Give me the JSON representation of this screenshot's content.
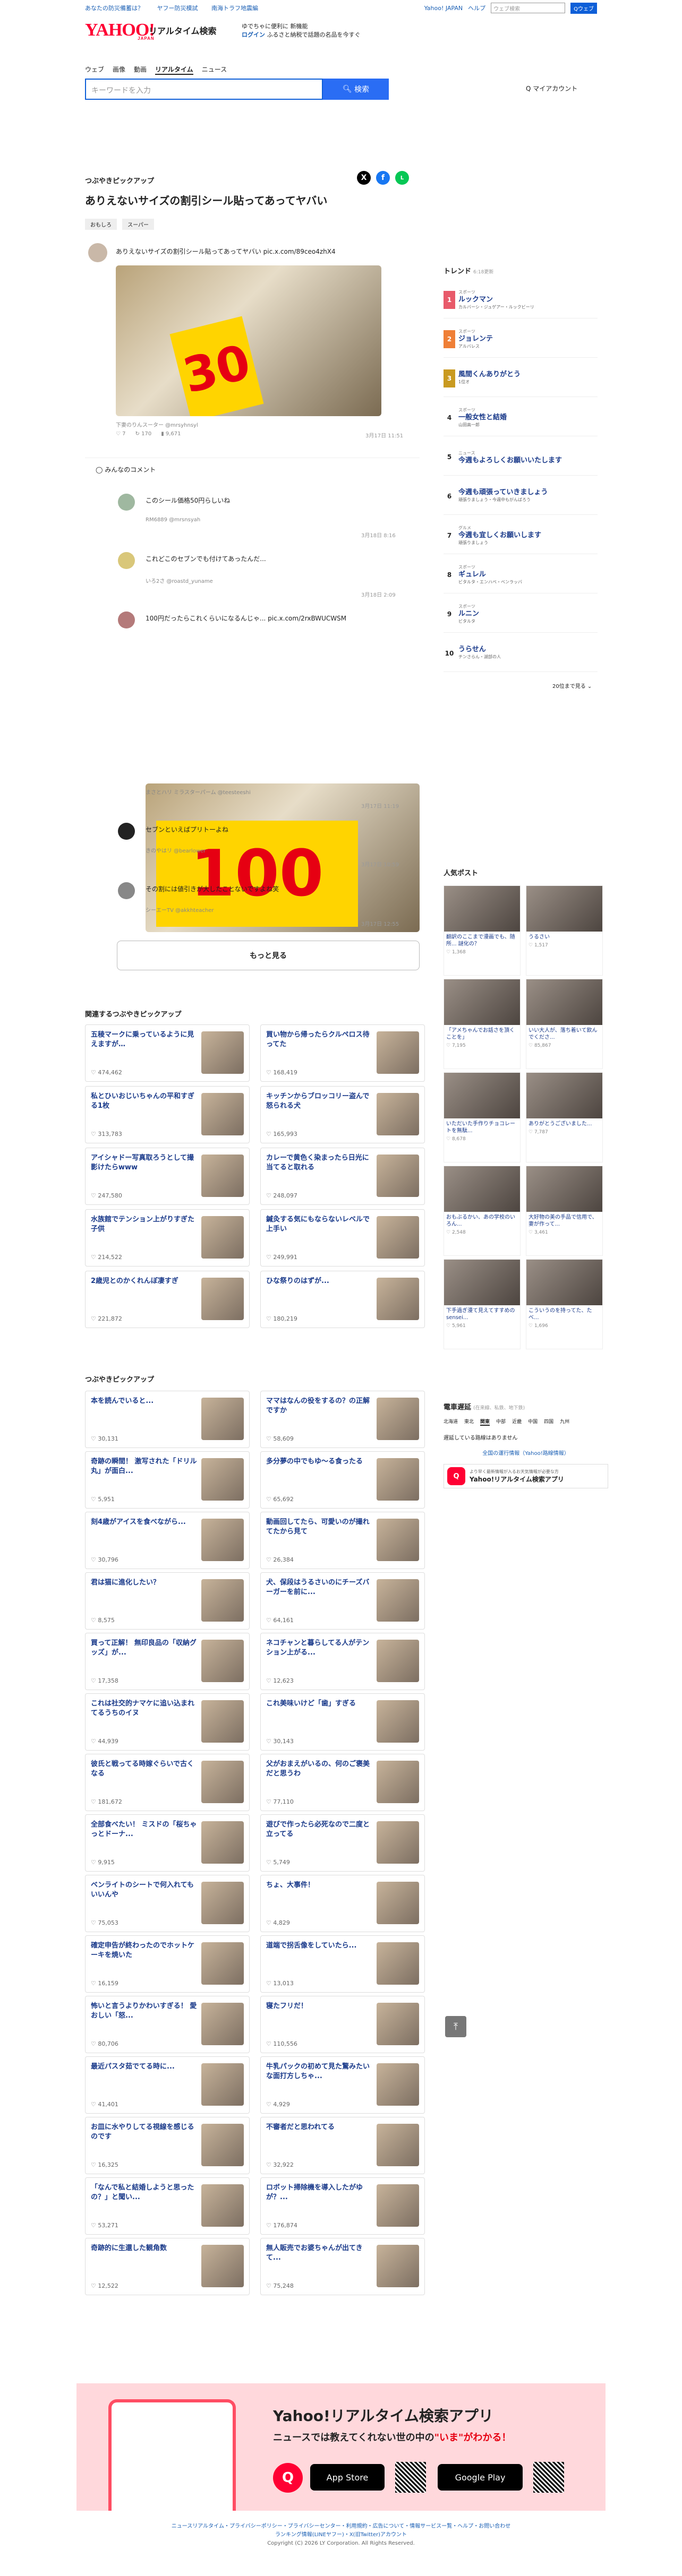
{
  "topbar": {
    "links": [
      "あなたの防災備蓄は？",
      "ヤフー防災模試",
      "南海トラフ地震編"
    ],
    "yahoo_japan": "Yahoo! JAPAN",
    "help": "ヘルプ",
    "search_placeholder": "ウェブ検索",
    "search_btn": "Qウェブ"
  },
  "header": {
    "logo": "YAHOO!",
    "logo_sub": "JAPAN",
    "title": "リアルタイム検索",
    "promo1": "ゆでちゃに便利に 新機能",
    "promo2": "ログイン",
    "promo3": "ふるさと納税で話題の名品を今すぐ"
  },
  "nav": {
    "items": [
      "ウェブ",
      "画像",
      "動画",
      "リアルタイム",
      "ニュース"
    ]
  },
  "search": {
    "placeholder": "キーワードを入力",
    "button": "検索",
    "mylink": "Q マイアカウント"
  },
  "main": {
    "pickup_label": "つぶやきピックアップ",
    "headline": "ありえないサイズの割引シール貼ってあってヤバい",
    "tags": [
      "おもしろ",
      "スーパー"
    ],
    "post1": {
      "text": "ありえないサイズの割引シール貼ってあってヤバい pic.x.com/89ceo4zhX4",
      "sticker": "30",
      "user": "下妻のりんスーター @mrsyhnsyl",
      "likes": "7",
      "rts": "170",
      "views": "9,671",
      "date": "3月17日 11:51"
    },
    "comments_label": "みんなのコメント",
    "c1": {
      "text": "このシール価格50円らしいね",
      "user": "RM6889 @mrsnsyah",
      "date": "3月18日 8:16"
    },
    "c2": {
      "text": "これどこのセブンでも付けてあったんだ...",
      "user": "いろ2さ @roastd_yuname",
      "date": "3月18日 2:09"
    },
    "c3": {
      "text": "100円だったらこれくらいになるんじゃ... pic.x.com/2rxBWUCWSM",
      "sticker": "100",
      "user": "まさとハリ ミラスターパーム @teesteeshi",
      "date": "3月17日 11:19"
    },
    "c4": {
      "text": "セブンといえばプリトーよね",
      "user": "きのやはリ @bearlower",
      "date": "3月17日 10:59"
    },
    "c5": {
      "text": "その割には値引きが大したことないですよね笑",
      "user": "シーエーTV @akkhteacher",
      "date": "3月17日 12:55"
    },
    "more": "もっと見る",
    "related_label": "関連するつぶやきピックアップ",
    "related": [
      {
        "t": "五稜マークに乗っているように見えますが…",
        "c": "474,462"
      },
      {
        "t": "買い物から帰ったらクルペロス待ってた",
        "c": "168,419"
      },
      {
        "t": "私とひいおじいちゃんの平和すぎる1枚",
        "c": "313,783"
      },
      {
        "t": "キッチンからブロッコリー盗んで怒られる犬",
        "c": "165,993"
      },
      {
        "t": "アイシャドー写真取ろうとして撮影けたらwww",
        "c": "247,580"
      },
      {
        "t": "カレーで黄色く染まったら日光に当てると取れる",
        "c": "248,097"
      },
      {
        "t": "水族館でテンション上がりすぎた子供",
        "c": "214,522"
      },
      {
        "t": "鍼灸する気にもならないレベルで上手い",
        "c": "249,991"
      },
      {
        "t": "2歳児とのかくれんぼ凄すぎ",
        "c": "221,872"
      },
      {
        "t": "ひな祭りのはずが...",
        "c": "180,219"
      }
    ],
    "pickup2_label": "つぶやきピックアップ",
    "pickups": [
      {
        "t": "本を読んでいると...",
        "c": "30,131"
      },
      {
        "t": "ママはなんの役をするの？の正解ですか",
        "c": "58,609"
      },
      {
        "t": "奇跡の瞬間！ 激写された「ドリル丸」が面白...",
        "c": "5,951"
      },
      {
        "t": "多分夢の中でもゆ〜る食ったる",
        "c": "65,692"
      },
      {
        "t": "刻4歳がアイスを食べながら...",
        "c": "30,796"
      },
      {
        "t": "動画回してたら、可愛いのが撮れてたから見て",
        "c": "26,384"
      },
      {
        "t": "君は猫に進化したい？",
        "c": "8,575"
      },
      {
        "t": "犬、保段はうるさいのにチーズバーガーを前に...",
        "c": "64,161"
      },
      {
        "t": "買って正解！ 無印良品の「収納グッズ」が...",
        "c": "17,358"
      },
      {
        "t": "ネコチャンと暮らしてる人がテンション上がる...",
        "c": "12,623"
      },
      {
        "t": "これは社交的ナマケに追い込まれてるうちのイヌ",
        "c": "44,939"
      },
      {
        "t": "これ美味いけど「歯」すぎる",
        "c": "30,143"
      },
      {
        "t": "彼氏と戦ってる時嫁ぐらいで古くなる",
        "c": "181,672"
      },
      {
        "t": "父がおまえがいるの、何のご褒美だと思うわ",
        "c": "77,110"
      },
      {
        "t": "全部食べたい！ ミスドの「桜ちゃっとドーナ...",
        "c": "9,915"
      },
      {
        "t": "遊びで作ったら必死なので二度と立ってる",
        "c": "5,749"
      },
      {
        "t": "ベンライトのシートで何入れてもいいんや",
        "c": "75,053"
      },
      {
        "t": "ちょ、大事件！",
        "c": "4,829"
      },
      {
        "t": "確定申告が終わったのでホットケーキを焼いた",
        "c": "16,159"
      },
      {
        "t": "道端で拐舌像をしていたら...",
        "c": "13,013"
      },
      {
        "t": "怖いと言うよりかわいすぎる！ 愛おしい「怒...",
        "c": "80,706"
      },
      {
        "t": "寝たフリだ！",
        "c": "110,556"
      },
      {
        "t": "最近パスタ茹でてる時に...",
        "c": "41,401"
      },
      {
        "t": "牛乳パックの初めて見た驚みたいな面打方しちゃ...",
        "c": "4,929"
      },
      {
        "t": "お皿に水やりしてる視線を感じるのです",
        "c": "16,325"
      },
      {
        "t": "不審者だと思われてる",
        "c": "32,922"
      },
      {
        "t": "「なんで私と結婚しようと思ったの？」と聞い...",
        "c": "53,271"
      },
      {
        "t": "ロボット掃除機を導入したがゆが？...",
        "c": "176,874"
      },
      {
        "t": "奇跡的に生還した観角数",
        "c": "12,522"
      },
      {
        "t": "無人販売でお婆ちゃんが出てきて...",
        "c": "75,248"
      }
    ]
  },
  "side": {
    "trend_label": "トレンド",
    "trend_sub": "6:18更新",
    "trends": [
      {
        "n": "1",
        "cat": "スポーツ",
        "w": "ルックマン",
        "d": "カルバーシ・ジュゲアー・ルックビーリ",
        "col": "#e85a6a"
      },
      {
        "n": "2",
        "cat": "スポーツ",
        "w": "ジョレンテ",
        "d": "アルバレス",
        "col": "#ef7f36"
      },
      {
        "n": "3",
        "cat": "",
        "w": "風間くんありがとう",
        "d": "1位オ",
        "col": "#c99a20"
      },
      {
        "n": "4",
        "cat": "スポーツ",
        "w": "一般女性と結婚",
        "d": "山田高一郎",
        "col": ""
      },
      {
        "n": "5",
        "cat": "ニュース",
        "w": "今週もよろしくお願いいたします",
        "d": "",
        "col": ""
      },
      {
        "n": "6",
        "cat": "",
        "w": "今週も頑張っていきましょう",
        "d": "頑張りましょう・今週中もがんばろう",
        "col": ""
      },
      {
        "n": "7",
        "cat": "グルメ",
        "w": "今週も宜しくお願いします",
        "d": "頑張りましょう",
        "col": ""
      },
      {
        "n": "8",
        "cat": "スポーツ",
        "w": "ギュレル",
        "d": "ビタルタ・エンハペ・ベンラッバ",
        "col": ""
      },
      {
        "n": "9",
        "cat": "スポーツ",
        "w": "ルニン",
        "d": "ビタルタ",
        "col": ""
      },
      {
        "n": "10",
        "cat": "",
        "w": "うらせん",
        "d": "チンさらん・湖部の人",
        "col": ""
      }
    ],
    "trend_more": "20位まで見る",
    "popular_label": "人気ポスト",
    "popular": [
      {
        "t": "翻訳のここまで漫画でも、随所... 謎化の？",
        "c": "1,368"
      },
      {
        "t": "うるさい",
        "c": "1,517"
      },
      {
        "t": "「アメちゃんでお話さを頂くことを」",
        "c": "7,195"
      },
      {
        "t": "いい大人が、落ち着いて飲んでくださ...",
        "c": "85,867"
      },
      {
        "t": "いただいた手作りチョコレートを無駄...",
        "c": "8,678"
      },
      {
        "t": "ありがとうございました...",
        "c": "7,787"
      },
      {
        "t": "おもぶるかい、あの学校のいろん...",
        "c": "2,548"
      },
      {
        "t": "大好物の美の手品で信用で、妻が作って...",
        "c": "3,461"
      },
      {
        "t": "下手過ぎ漫て見えてすすめのsensei...",
        "c": "5,961"
      },
      {
        "t": "こういうのを持ってた、たべ...",
        "c": "1,696"
      }
    ],
    "station_label": "電車遅延",
    "station_sub": "(在来線、私鉄、地下鉄)",
    "regions": [
      "北海道",
      "東北",
      "関東",
      "中部",
      "近畿",
      "中国",
      "四国",
      "九州"
    ],
    "station_text": "遅延している路線はありません",
    "station_link": "全国の運行情報（Yahoo!路線情報）",
    "app_text": "Yahoo!リアルタイム検索アプリ",
    "app_sub": "より早く最新情報が入るお天気情報が必要な方"
  },
  "banner": {
    "title": "Yahoo!リアルタイム検索アプリ",
    "sub": "ニュースでは教えてくれない世の中の",
    "sub2": "\"いま\"がわかる！",
    "appstore": "App Store",
    "googleplay": "Google Play"
  },
  "footer": {
    "links": "ニュースリアルタイム・プライバシーポリシー・プライバシーセンター・利用規約・広告について・情報サービスー覧・ヘルプ・お問い合わせ",
    "line2": "ランキング情報(LINEヤフー)・X(旧Twitter)アカウント",
    "copy": "Copyright (C) 2026 LY Corporation. All Rights Reserved."
  }
}
